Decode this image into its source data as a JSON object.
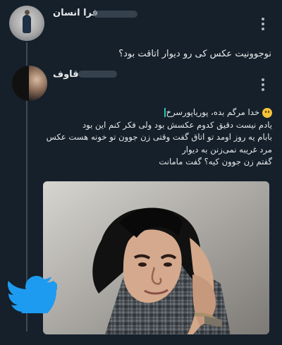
{
  "thread": {
    "reply": {
      "display_name": "فرا انسان",
      "text": "نوجوونیت عکس کی رو دیوار اتاقت بود؟"
    },
    "quote": {
      "display_name": "قاوف",
      "lines": [
        "خدا مرگم بده، پوریاپورسرخ",
        "یادم نیست دقیق کدوم عکسش بود ولی فکر کنم این بود",
        "بابام یه روز اومد تو اتاق گفت وقتی زن جوون تو خونه هست عکس",
        "مرد غریبه نمی‌زنن به دیوار",
        "گفتم زن جوون کیه؟ گفت مامانت"
      ]
    }
  },
  "icons": {
    "menu_1": "more-vertical-icon",
    "menu_2": "more-vertical-icon",
    "brand": "twitter-bird-icon",
    "emoji": "smiling-face-icon"
  },
  "colors": {
    "background": "#15202b",
    "text": "#e7e9ea",
    "thread_line": "#3d4a57",
    "twitter_blue": "#1d9bf0",
    "emoji": "#f5c33b"
  }
}
